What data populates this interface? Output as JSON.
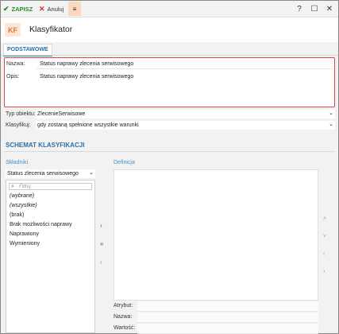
{
  "toolbar": {
    "save_label": "ZAPISZ",
    "cancel_label": "Anuluj",
    "menu_icon": "≡",
    "help_icon": "?",
    "maximize_icon": "☐",
    "close_icon": "✕"
  },
  "header": {
    "logo_text": "KF",
    "title": "Klasyfikator"
  },
  "tabs": {
    "basic": "PODSTAWOWE"
  },
  "form": {
    "name_label": "Nazwa:",
    "name_value": "Status naprawy zlecenia serwisowego",
    "desc_label": "Opis:",
    "desc_value": "Status naprawy zlecenia serwisowego",
    "object_type_label": "Typ obiektu:",
    "object_type_value": "ZlecenieSerwisowe",
    "classify_label": "Klasyfikuj:",
    "classify_value": "gdy zostaną spełnione wszystkie warunki"
  },
  "schema": {
    "title": "SCHEMAT KLASYFIKACJI",
    "components_label": "Składniki",
    "definition_label": "Definicja",
    "component_select": "Status zlecenia serwisowego",
    "filter_placeholder": "Filtruj",
    "items": [
      "(wybrane)",
      "(wszystkie)",
      "(brak)",
      "Brak możliwości naprawy",
      "Naprawiony",
      "Wymieniony"
    ],
    "move_one": "›",
    "move_all": "»",
    "move_back": "‹",
    "up": "˄",
    "down": "˅",
    "left": "‹",
    "right": "›",
    "attr_label": "Atrybut:",
    "name_label": "Nazwa:",
    "value_label": "Wartość:"
  }
}
